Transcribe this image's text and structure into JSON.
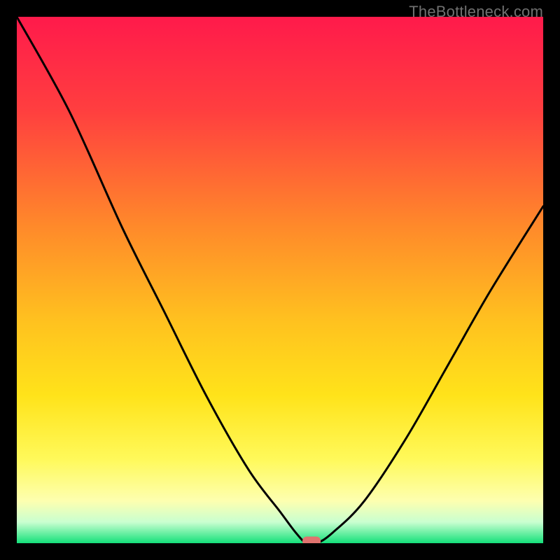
{
  "watermark": "TheBottleneck.com",
  "chart_data": {
    "type": "line",
    "title": "",
    "xlabel": "",
    "ylabel": "",
    "xlim": [
      0,
      100
    ],
    "ylim": [
      0,
      100
    ],
    "series": [
      {
        "name": "bottleneck-curve",
        "x": [
          0,
          10,
          20,
          28,
          36,
          44,
          50,
          53,
          55,
          57,
          60,
          66,
          74,
          82,
          90,
          100
        ],
        "values": [
          100,
          82,
          60,
          44,
          28,
          14,
          6,
          2,
          0,
          0,
          2,
          8,
          20,
          34,
          48,
          64
        ]
      }
    ],
    "marker": {
      "x": 56,
      "y": 0
    },
    "gradient_stops": [
      {
        "offset": 0,
        "color": "#ff1a4b"
      },
      {
        "offset": 18,
        "color": "#ff3f3f"
      },
      {
        "offset": 40,
        "color": "#ff8a2a"
      },
      {
        "offset": 58,
        "color": "#ffc21f"
      },
      {
        "offset": 72,
        "color": "#ffe31a"
      },
      {
        "offset": 84,
        "color": "#fff95a"
      },
      {
        "offset": 92,
        "color": "#fdffb0"
      },
      {
        "offset": 96,
        "color": "#c9ffd0"
      },
      {
        "offset": 100,
        "color": "#14e07a"
      }
    ]
  }
}
